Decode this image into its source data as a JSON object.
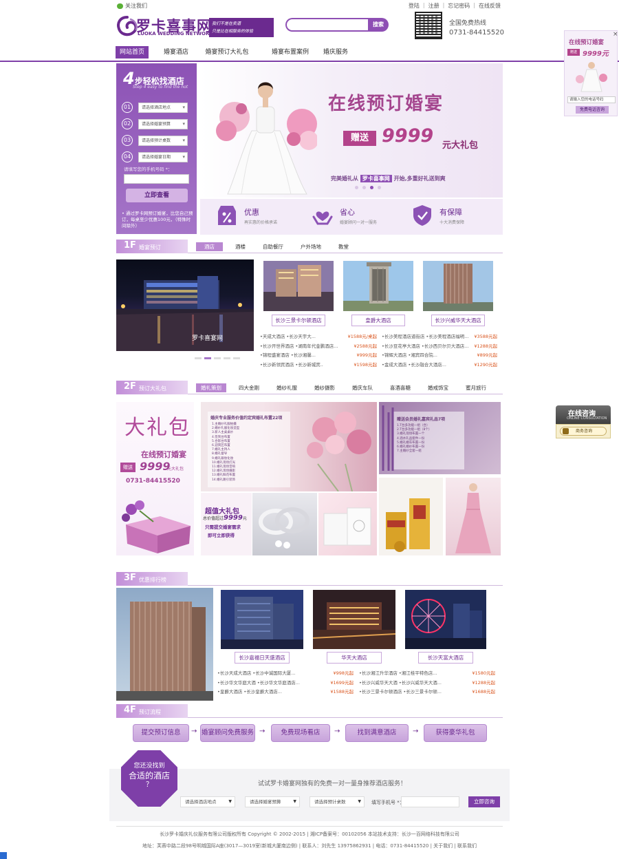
{
  "topbar": {
    "follow": "关注我们",
    "links": [
      "登陆",
      "注册",
      "忘记密码",
      "在线反馈"
    ]
  },
  "logo": {
    "cn": "罗卡喜事网",
    "en": "LUOKA WEDDING NETWORK",
    "slogan_1": "我们不是在卖酒",
    "slogan_2": "只是比在相服务的体验"
  },
  "search": {
    "placeholder": "",
    "button": "搜索"
  },
  "hotline": {
    "label": "全国免费热线",
    "number": "0731-84415520"
  },
  "nav": [
    "网站首页",
    "婚宴酒店",
    "婚宴预订大礼包",
    "婚宴布置案例",
    "婚庆服务"
  ],
  "steps": {
    "title_num": "4",
    "title": "步轻松找酒店",
    "subtitle": "Step 4 easy to find the hot",
    "items": [
      {
        "num": "01",
        "label": "请选择酒店地点"
      },
      {
        "num": "02",
        "label": "请选择婚宴预算"
      },
      {
        "num": "03",
        "label": "请选择预计桌数"
      },
      {
        "num": "04",
        "label": "请选择婚宴日期"
      }
    ],
    "phone_label": "请填写您的手机号码 *：",
    "submit": "立即查看",
    "note": "• 通过罗卡网预订婚宴，比您自己预订，每桌至少优惠100元，（特殊时间除外）"
  },
  "banner": {
    "title": "在线预订婚宴",
    "gift_label": "赠送",
    "gift_num": "9999",
    "gift_unit": "元大礼包",
    "tagline_pre": "完美婚礼从",
    "tagline_brand": "罗卡喜事网",
    "tagline_post": "开始,多重好礼送到爽"
  },
  "features": [
    {
      "title": "优惠",
      "sub": "再实惠的价格承诺"
    },
    {
      "title": "省心",
      "sub": "婚宴顾问一对一服务"
    },
    {
      "title": "有保障",
      "sub": "十大消费保障"
    }
  ],
  "floor1": {
    "fl": "1F",
    "title": "婚宴预订",
    "tabs": [
      "酒店",
      "酒楼",
      "自助餐厅",
      "户外场地",
      "教堂"
    ],
    "hotels": [
      "长沙三景卡尔顿酒店",
      "皇爵大酒店",
      "长沙兴威华天大酒店"
    ],
    "rows": [
      {
        "a": "•天成大酒店 •长沙天宇大...",
        "ap": "¥1588元/桌起",
        "b": "•长沙美程酒店道街店 •长沙美程酒店福明...",
        "bp": "¥3588元起"
      },
      {
        "a": "•长沙开世界酒店 •湖南年代金鹏酒店...",
        "ap": "¥2588元起",
        "b": "•长沙豆花亭大酒店 •长沙西贝尔贝大酒店...",
        "bp": "¥1288元起"
      },
      {
        "a": "•锦程盛宴酒店 •长沙湘馨...",
        "ap": "¥999元起",
        "b": "•锦辉大酒店 •湘宾四合院...",
        "bp": "¥899元起"
      },
      {
        "a": "•长沙新领宾酒店 •长沙新城宾..",
        "ap": "¥1598元起",
        "b": "•金成大酒店 •长沙融合大酒店...",
        "bp": "¥1290元起"
      }
    ]
  },
  "floor2": {
    "fl": "2F",
    "title": "预订大礼包",
    "tabs": [
      "婚礼策划",
      "四大金刚",
      "婚纱礼服",
      "婚纱摄影",
      "婚庆车队",
      "喜酒喜糖",
      "婚戒饰宝",
      "蜜月旅行"
    ],
    "panel": {
      "title": "大礼包",
      "line": "在线预订婚宴",
      "gift": "赠送",
      "num": "9999",
      "unit": "元大礼包",
      "phone": "0731-84415520"
    },
    "pk1_title": "婚庆专业服务价值约定宾婚礼布置22项",
    "pk1_items": [
      "1.主婚纱礼服拍摄",
      "2.婚纱礼服化妆造型",
      "3.新人主桌桌纱",
      "4.签到台布置",
      "5.合影台布置",
      "6.迎宾区布置",
      "7.婚礼主持人",
      "8.婚礼督导",
      "9.婚礼跟妆化妆",
      "10.婚礼现场灯光",
      "11.婚礼现场音响",
      "12.婚礼现场摄影",
      "13.婚礼鲜花布置",
      "14.婚礼路引装饰",
      "15.送餐服务",
      "16.婚宴菜单设计"
    ],
    "pk2_title": "赠送会员婚礼嘉宾礼品7项",
    "pk2_items": [
      "1.T台多功能一组（合）",
      "2.T台多功能一组（8个）",
      "3.婚礼现场布置一个",
      "4.酒水礼品套件一份",
      "5.婚礼婚车布置一份",
      "6.婚礼婚纱布置一份",
      "7.主婚纱全套一组"
    ],
    "pk3": {
      "t1": "超值大礼包",
      "t2a": "总价值超过",
      "t2b": "9999",
      "t2c": "元",
      "t3": "只需提交婚宴需求",
      "t4": "即可立即获得"
    }
  },
  "floor3": {
    "fl": "3F",
    "title": "优惠排行榜",
    "hotels": [
      "长沙嘉福日天盛酒店",
      "华天大酒店",
      "长沙天富大酒店"
    ],
    "rows": [
      {
        "a": "•长沙天成大酒店 •长沙中诚国际大厦...",
        "ap": "¥998元起",
        "b": "•长沙湘江升华酒店 •湘江桂平特色店...",
        "bp": "¥1580元起"
      },
      {
        "a": "•长沙华文华庭大酒 •长沙华文华庭酒店...",
        "ap": "¥1699元起",
        "b": "•长沙兴威华天大酒 •长沙兴威华天大酒...",
        "bp": "¥1288元起"
      },
      {
        "a": "•皇爵大酒店 •长沙皇爵大酒店...",
        "ap": "¥1588元起",
        "b": "•长沙三景卡尔顿酒店 •长沙三景卡尔顿...",
        "bp": "¥1688元起"
      }
    ]
  },
  "floor4": {
    "fl": "4F",
    "title": "预订流程",
    "steps": [
      "提交预订信息",
      "婚宴顾问免费服务",
      "免费现场看店",
      "找到满意酒店",
      "获得豪华礼包"
    ]
  },
  "bottom": {
    "badge_l1": "您还没找到",
    "badge_l2": "合适的酒店",
    "badge_l3": "？",
    "line": "试试罗卡婚宴网独有的免费一对一量身推荐酒店服务！",
    "selects": [
      "请选择酒店地点",
      "请选择婚宴预算",
      "请选择预计桌数"
    ],
    "phone_label": "填写手机号 *：",
    "button": "立即咨询"
  },
  "footer": {
    "l1": "长沙罗卡婚庆礼仪服务有限公司版权所有 Copyright © 2002-2015 | 湘ICP备案号：00102056 本站技术支持：长沙一百网络科技有限公司",
    "l2": "地址：芙蓉中路二段98号明城国际A座(3017—3019室(新城大厦南边侧) | 联系人：刘先生 13975862931 | 电话：0731-84415520 | 关于我们 | 联系我们"
  },
  "float_ad": {
    "close": "×",
    "title": "在线预订婚宴",
    "gift": "赠送",
    "num": "9999元",
    "phone": "请输入您的电话号码",
    "button": "免费电话咨询"
  },
  "consult": {
    "title": "在线咨询",
    "sub": "ONLINE CONSULTATION",
    "button": "商务咨询"
  }
}
